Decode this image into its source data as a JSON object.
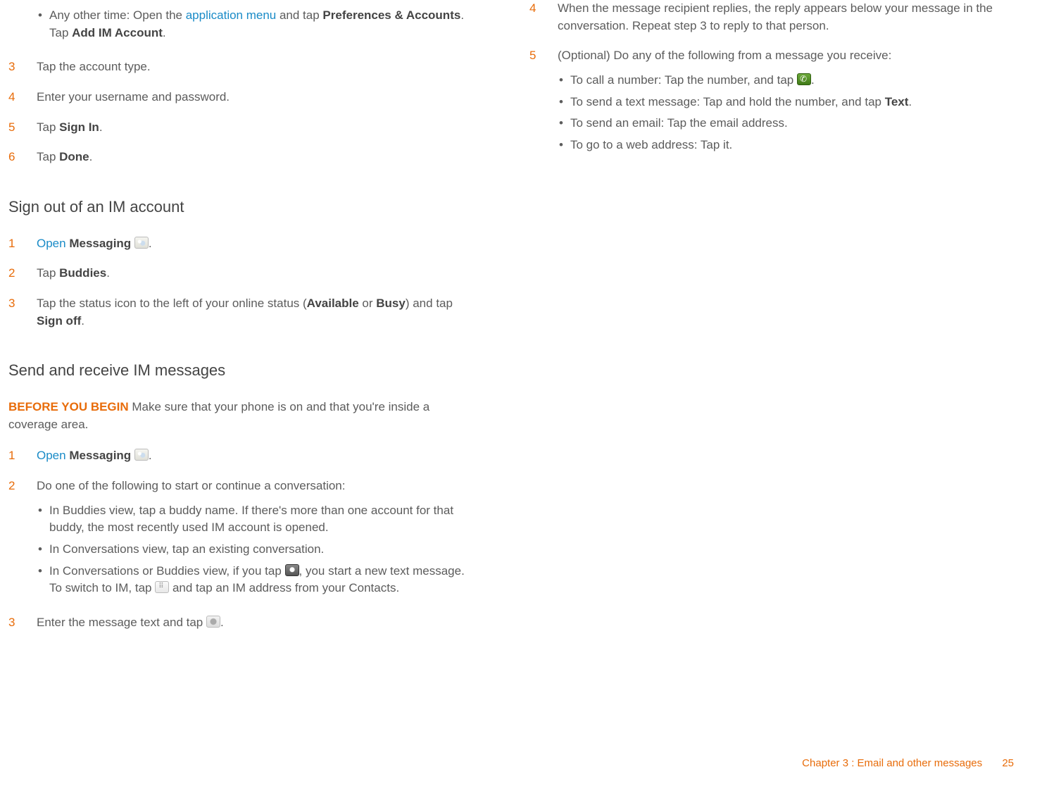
{
  "leftCol": {
    "continuedBullet": {
      "prefix": "Any other time: Open the ",
      "link": "application menu",
      "mid1": " and tap ",
      "b1": "Preferences & Accounts",
      "mid2": ". Tap ",
      "b2": "Add IM Account",
      "end": "."
    },
    "step3": {
      "num": "3",
      "text": "Tap the account type."
    },
    "step4": {
      "num": "4",
      "text": "Enter your username and password."
    },
    "step5": {
      "num": "5",
      "pre": "Tap ",
      "b": "Sign In",
      "post": "."
    },
    "step6": {
      "num": "6",
      "pre": "Tap ",
      "b": "Done",
      "post": "."
    },
    "h2a": "Sign out of an IM account",
    "soStep1": {
      "num": "1",
      "link": "Open",
      "space": " ",
      "b": "Messaging",
      "post": " ",
      "end": "."
    },
    "soStep2": {
      "num": "2",
      "pre": "Tap ",
      "b": "Buddies",
      "post": "."
    },
    "soStep3": {
      "num": "3",
      "pre": "Tap the status icon to the left of your online status (",
      "b1": "Available",
      "mid": " or ",
      "b2": "Busy",
      "mid2": ") and tap ",
      "b3": "Sign off",
      "post": "."
    },
    "h2b": "Send and receive IM messages",
    "byb": {
      "label": "BEFORE YOU BEGIN",
      "text": " Make sure that your phone is on and that you're inside a coverage area."
    },
    "srStep1": {
      "num": "1",
      "link": "Open",
      "b": "Messaging",
      "post": " ",
      "end": "."
    },
    "srStep2": {
      "num": "2",
      "text": "Do one of the following to start or continue a conversation:",
      "b1": "In Buddies view, tap a buddy name. If there's more than one account for that buddy, the most recently used IM account is opened.",
      "b2": "In Conversations view, tap an existing conversation.",
      "b3a": "In Conversations or Buddies view, if you tap ",
      "b3b": ", you start a new text message. To switch to IM, tap ",
      "b3c": " and tap an IM address from your Contacts."
    },
    "srStep3": {
      "num": "3",
      "pre": "Enter the message text and tap ",
      "post": "."
    }
  },
  "rightCol": {
    "step4": {
      "num": "4",
      "text": "When the message recipient replies, the reply appears below your message in the conversation. Repeat step 3 to reply to that person."
    },
    "step5": {
      "num": "5",
      "text": "(Optional) Do any of the following from a message you receive:",
      "b1a": "To call a number: Tap the number, and tap ",
      "b1b": ".",
      "b2a": "To send a text message: Tap and hold the number, and tap ",
      "b2bold": "Text",
      "b2b": ".",
      "b3": "To send an email: Tap the email address.",
      "b4": "To go to a web address: Tap it."
    }
  },
  "footer": {
    "chapter": "Chapter 3  :  Email and other messages",
    "page": "25"
  }
}
